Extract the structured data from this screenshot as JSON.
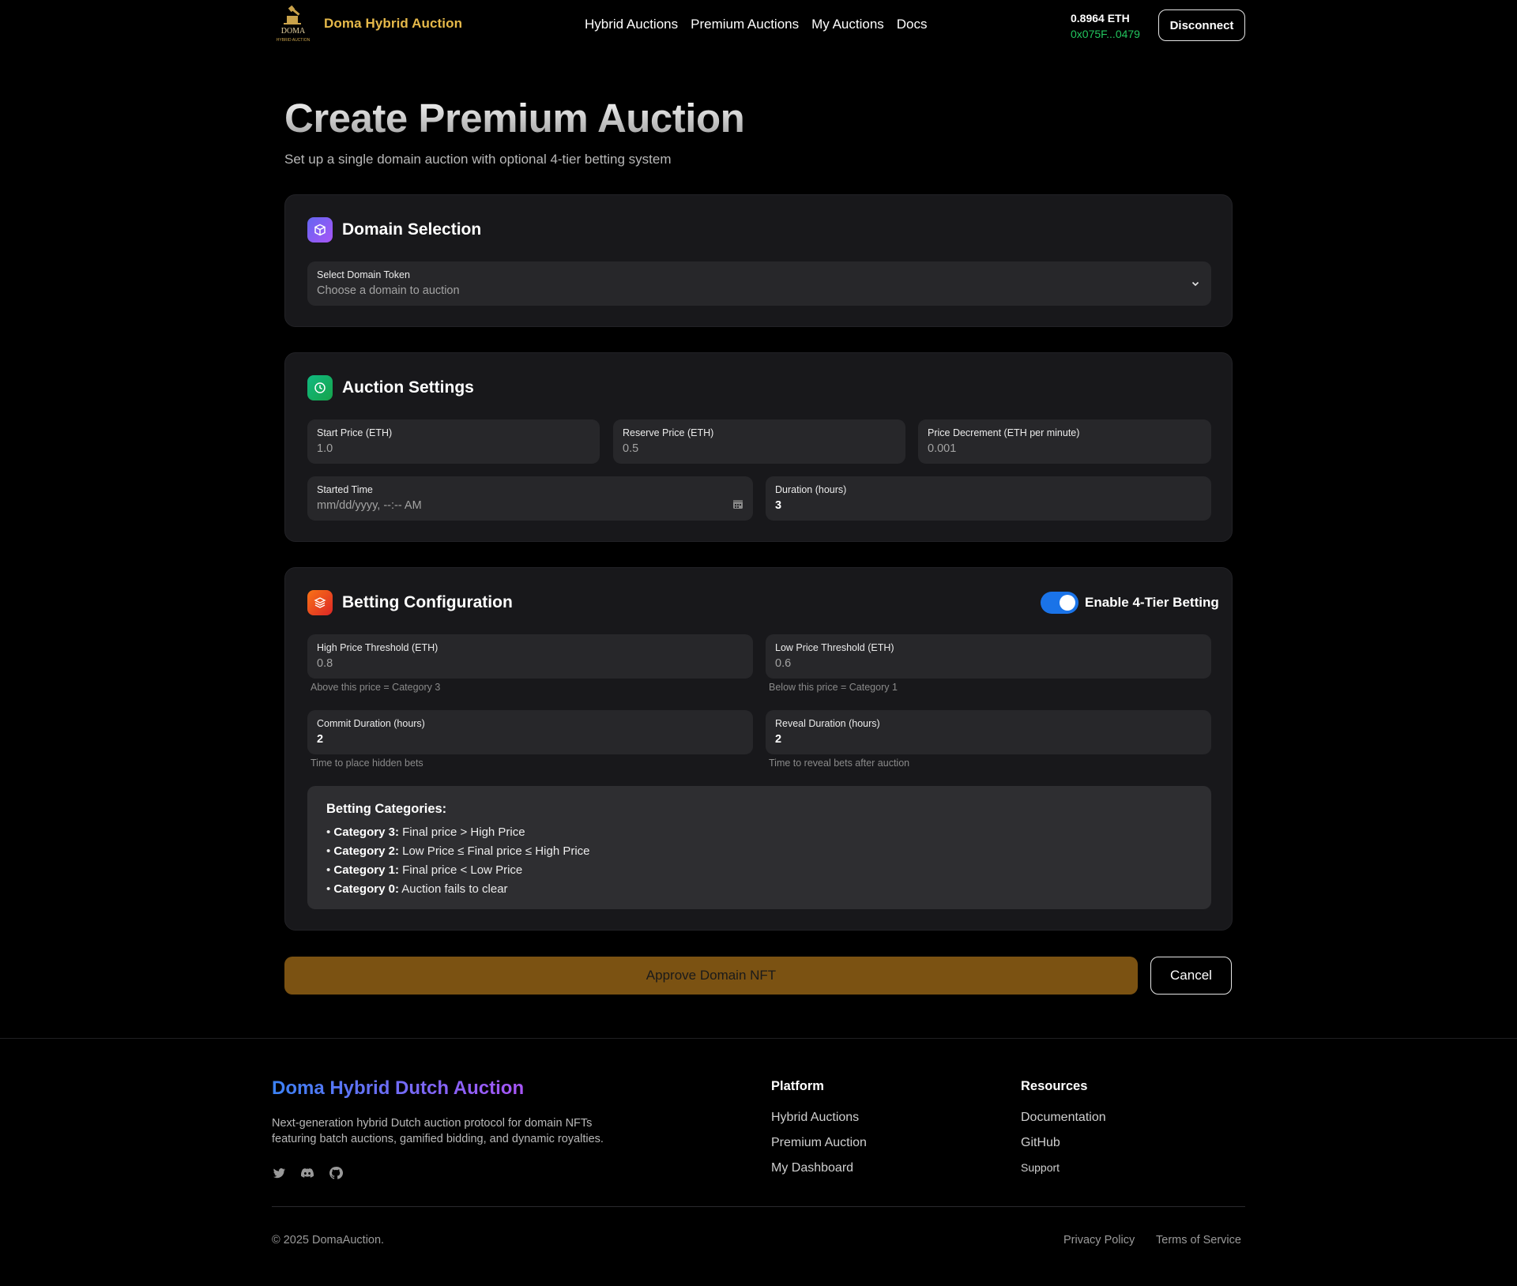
{
  "header": {
    "logo_text_top": "DOMA",
    "logo_text_bottom": "HYBRID AUCTION",
    "brand": "Doma Hybrid Auction",
    "nav": [
      "Hybrid Auctions",
      "Premium Auctions",
      "My Auctions",
      "Docs"
    ],
    "balance": "0.8964 ETH",
    "address": "0x075F...0479",
    "disconnect_label": "Disconnect"
  },
  "page": {
    "title": "Create Premium Auction",
    "subtitle": "Set up a single domain auction with optional 4-tier betting system"
  },
  "domain_selection": {
    "title": "Domain Selection",
    "select_label": "Select Domain Token",
    "select_value": "Choose a domain to auction"
  },
  "auction_settings": {
    "title": "Auction Settings",
    "start_price_label": "Start Price (ETH)",
    "start_price": "1.0",
    "reserve_price_label": "Reserve Price (ETH)",
    "reserve_price": "0.5",
    "decrement_label": "Price Decrement (ETH per minute)",
    "decrement": "0.001",
    "started_time_label": "Started Time",
    "started_time_placeholder": "mm/dd/yyyy, --:-- AM",
    "duration_label": "Duration (hours)",
    "duration": "3"
  },
  "betting": {
    "title": "Betting Configuration",
    "toggle_label": "Enable 4-Tier Betting",
    "toggle_on": true,
    "high_label": "High Price Threshold (ETH)",
    "high_value": "0.8",
    "high_help": "Above this price = Category 3",
    "low_label": "Low Price Threshold (ETH)",
    "low_value": "0.6",
    "low_help": "Below this price = Category 1",
    "commit_label": "Commit Duration (hours)",
    "commit_value": "2",
    "commit_help": "Time to place hidden bets",
    "reveal_label": "Reveal Duration (hours)",
    "reveal_value": "2",
    "reveal_help": "Time to reveal bets after auction",
    "categories_title": "Betting Categories:",
    "categories": [
      {
        "name": "Category 3:",
        "desc": "Final price > High Price"
      },
      {
        "name": "Category 2:",
        "desc": "Low Price ≤ Final price ≤ High Price"
      },
      {
        "name": "Category 1:",
        "desc": "Final price < Low Price"
      },
      {
        "name": "Category 0:",
        "desc": "Auction fails to clear"
      }
    ]
  },
  "actions": {
    "approve_label": "Approve Domain NFT",
    "cancel_label": "Cancel"
  },
  "footer": {
    "brand": "Doma Hybrid Dutch Auction",
    "description": "Next-generation hybrid Dutch auction protocol for domain NFTs featuring batch auctions, gamified bidding, and dynamic royalties.",
    "socials": [
      "twitter-icon",
      "discord-icon",
      "github-icon"
    ],
    "platform_title": "Platform",
    "platform_links": [
      "Hybrid Auctions",
      "Premium Auction",
      "My Dashboard"
    ],
    "resources_title": "Resources",
    "resources_links": [
      "Documentation",
      "GitHub",
      "Support"
    ],
    "copyright": "© 2025 DomaAuction.",
    "privacy": "Privacy Policy",
    "terms": "Terms of Service"
  },
  "colors": {
    "brand_gold": "#e6b94a",
    "address_green": "#22c55e",
    "toggle_blue": "#1a73e8",
    "approve_bg": "#7b5212"
  }
}
